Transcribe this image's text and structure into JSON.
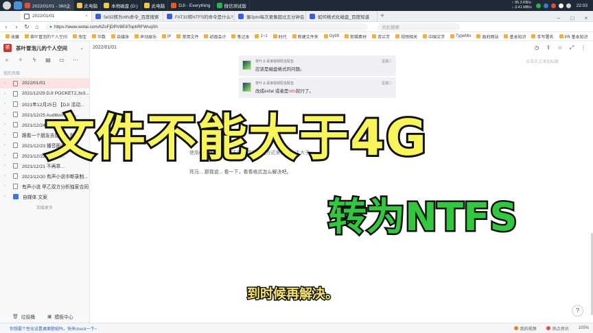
{
  "taskbar": {
    "tabs": [
      {
        "label": "2022/01/01 - 360企",
        "color": "#e94b3c"
      },
      {
        "label": "此电脑",
        "color": "#f2c744"
      },
      {
        "label": "本地磁盘 (D:)",
        "color": "#f2c744"
      },
      {
        "label": "此电脑",
        "color": "#f2c744"
      },
      {
        "label": "DJI - Everything",
        "color": "#e65a28"
      },
      {
        "label": "微信测试版",
        "color": "#2bb24c"
      }
    ],
    "net_up": "↑ 95.3 KB/s",
    "net_down": "↓ 3.41 MB/s",
    "time": "22:03"
  },
  "browser": {
    "tabs": [
      {
        "label": "2022/01/01",
        "active": true
      },
      {
        "label": "fat32转为ntfs命令_百度搜索",
        "active": false
      },
      {
        "label": "FAT32转NTFS的命令是什么?_",
        "active": false
      },
      {
        "label": "御2pro每次录像超过五分钟会",
        "active": false
      },
      {
        "label": "如何格式化磁盘_百度知道",
        "active": false
      }
    ],
    "url": "https://www.wolai.com/hZsFjDRV8E8TophRFWsqSh",
    "search_placeholder": "点此搜索",
    "bookmarks": [
      "收藏",
      "茶叶冒泡的个人空间",
      "淘宝",
      "华数",
      "自媒体",
      "声动娱乐",
      "pr",
      "常用文件",
      "初级会计",
      "笔记本",
      "1~1",
      "时代",
      "新建文件夹",
      "Gy99",
      "剪辑素材",
      "双兰芳",
      "视频相关",
      "中国文学",
      "TypeMix",
      "政府网站",
      "基本知识",
      "手写署名",
      "PR 基本知识",
      "PR Wind",
      "模板图片"
    ]
  },
  "sidebar": {
    "workspace_logo": "茶",
    "workspace_name": "茶叶冒泡儿的个人空间",
    "section_label": "我的页面",
    "pages": [
      {
        "label": "2022/01/01",
        "active": true
      },
      {
        "label": "2021/12/29 DJI POCKET2,3x3...",
        "active": false
      },
      {
        "label": "2021年12月25日 【DJI 活动...",
        "active": false
      },
      {
        "label": "2021/12/25 Audition 不能...",
        "active": false
      },
      {
        "label": "2021/12/24 墨子笑...",
        "active": false
      },
      {
        "label": "跟看一个朋友去提车。 朋...",
        "active": false
      },
      {
        "label": "2021/12/23 播音面对工作...",
        "active": false
      },
      {
        "label": "2021/12/22 为什么...",
        "active": false
      },
      {
        "label": "2021/12/21 不再章...",
        "active": false
      },
      {
        "label": "2021/12/20 有声小说中断录制...",
        "active": false
      },
      {
        "label": "有声小说 甲乙双方分析独家合同",
        "active": false
      }
    ],
    "folder_label": "自媒体 文案",
    "load_more": "加载更多",
    "trash_label": "垃圾桶",
    "template_label": "模板中心"
  },
  "main": {
    "breadcrumb": "2022/01/01",
    "add_hint": "点击正文添加标题",
    "quotes": [
      {
        "source": "茶叶 & 承接视频配音配音",
        "text": "应该是磁盘格式的问题。",
        "time": "星期二"
      },
      {
        "source": "茶叶 & 承接视频配音配音",
        "text_before": "改成exfat 或者是",
        "text_highlight": "ntfs",
        "text_after": "就行了。",
        "time": "星期二"
      }
    ],
    "body_line1": "使用exFAT... 了解一下后... 用相同的方式来把它... 主大于 ...",
    "body_line2": "死马... 那我说... 看一下，看看格式怎么解决吧。"
  },
  "overlay": {
    "big_title": "文件不能大于4G",
    "sub_title": "转为NTFS",
    "caption": "到时候再解决。"
  },
  "statusbar": {
    "left_text": "你想要个性化设置桌面壁纸吗，快来check一下~",
    "items": [
      "我的视频",
      "热点资讯"
    ],
    "zoom": "105%"
  }
}
